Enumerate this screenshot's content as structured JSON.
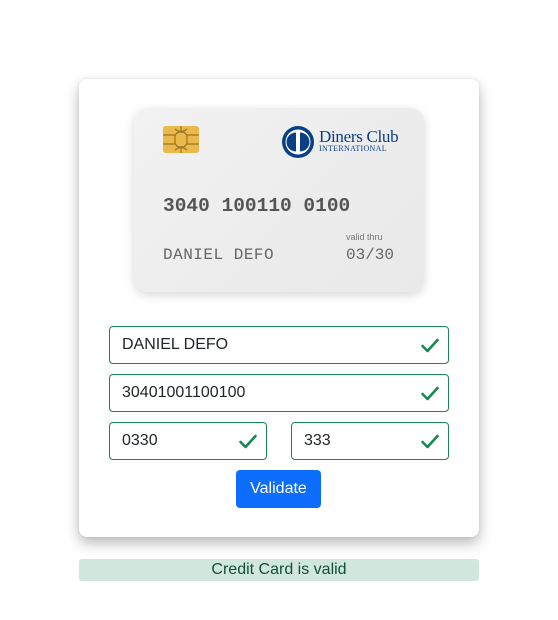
{
  "card": {
    "number": "3040 100110 0100",
    "holder": "DANIEL DEFO",
    "valid_label": "valid thru",
    "expiry": "03/30",
    "brand_line1": "Diners Club",
    "brand_line2": "INTERNATIONAL"
  },
  "form": {
    "name_value": "DANIEL DEFO",
    "number_value": "30401001100100",
    "expiry_value": "0330",
    "cvv_value": "333",
    "validate_label": "Validate"
  },
  "status": {
    "message": "Credit Card is valid"
  },
  "colors": {
    "valid": "#198754",
    "primary": "#0d6efd",
    "alert_bg": "#d1e7dd",
    "alert_text": "#0f5132",
    "brand": "#0a3f86",
    "chip": "#e9b94c"
  },
  "icons": [
    "chip-icon",
    "diners-club-logo",
    "check-icon"
  ]
}
